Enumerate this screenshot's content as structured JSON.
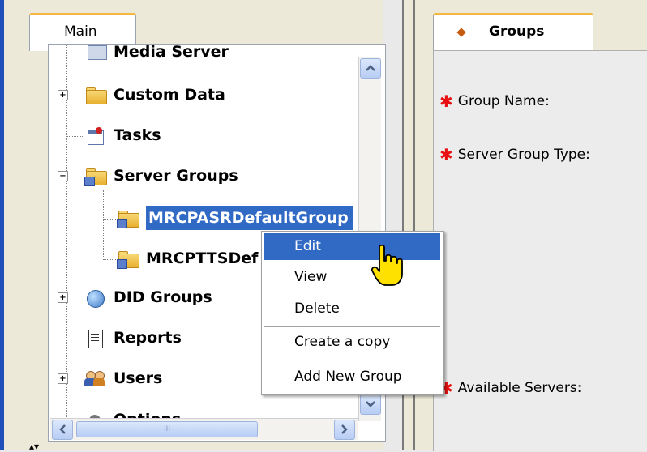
{
  "left_tab": {
    "label": "Main"
  },
  "tree": {
    "nodes": [
      {
        "label": "Media Server"
      },
      {
        "label": "Custom Data",
        "expander": "+"
      },
      {
        "label": "Tasks"
      },
      {
        "label": "Server Groups",
        "expander": "−"
      },
      {
        "label": "MRCPASRDefaultGroup"
      },
      {
        "label": "MRCPTTSDef"
      },
      {
        "label": "DID Groups",
        "expander": "+"
      },
      {
        "label": "Reports"
      },
      {
        "label": "Users",
        "expander": "+"
      },
      {
        "label": "Options"
      }
    ]
  },
  "context_menu": {
    "items": [
      "Edit",
      "View",
      "Delete",
      "Create a copy",
      "Add New Group"
    ],
    "highlighted": "Edit"
  },
  "right_tab": {
    "label": "Groups"
  },
  "form": {
    "group_name_label": "Group Name:",
    "server_group_type_label": "Server Group Type:",
    "available_servers_label": "Available Servers:"
  },
  "scrollbar": {
    "thumb_grip": "III"
  },
  "colors": {
    "selection": "#316ac5",
    "required": "#e81010",
    "tab_accent": "#f4b840",
    "window_border": "#1f4fb8"
  }
}
